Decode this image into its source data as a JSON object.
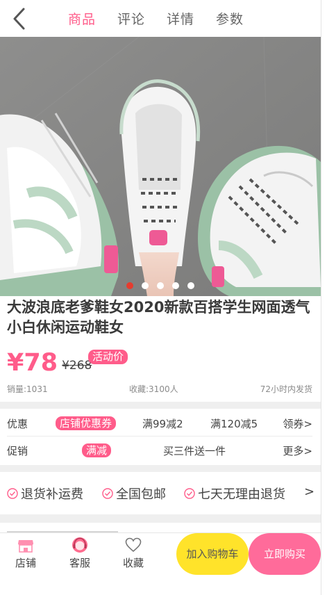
{
  "header": {
    "back_icon": "chevron-left-icon",
    "tabs": [
      {
        "label": "商品",
        "active": true
      },
      {
        "label": "评论",
        "active": false
      },
      {
        "label": "详情",
        "active": false
      },
      {
        "label": "参数",
        "active": false
      }
    ]
  },
  "gallery": {
    "slide_count": 5,
    "active_index": 0
  },
  "product": {
    "title": "大波浪底老爹鞋女2020新款百搭学生网面透气小白休闲运动鞋女",
    "price": "¥78",
    "original_price": "¥268",
    "promo_tag": "活动价",
    "sales": "销量:1031",
    "favorites": "收藏:3100人",
    "shipping": "72小时内发货"
  },
  "offers": {
    "discount_label": "优惠",
    "discount_tag": "店铺优惠券",
    "deal_1": "满99减2",
    "deal_2": "满120减5",
    "coupon_link": "领券>",
    "promo_label": "促销",
    "promo_tag": "满减",
    "promo_text": "买三件送一件",
    "more_link": "更多>"
  },
  "services": {
    "items": [
      "退货补运费",
      "全国包邮",
      "七天无理由退货"
    ],
    "arrow": ">"
  },
  "bottom_bar": {
    "store": "店铺",
    "service": "客服",
    "favorite": "收藏",
    "add_to_cart": "加入购物车",
    "buy_now": "立即购买"
  },
  "colors": {
    "accent": "#ff5c8a",
    "cart": "#ffe32a",
    "buy": "#ff6b9a",
    "active_dot": "#e63b2e"
  }
}
